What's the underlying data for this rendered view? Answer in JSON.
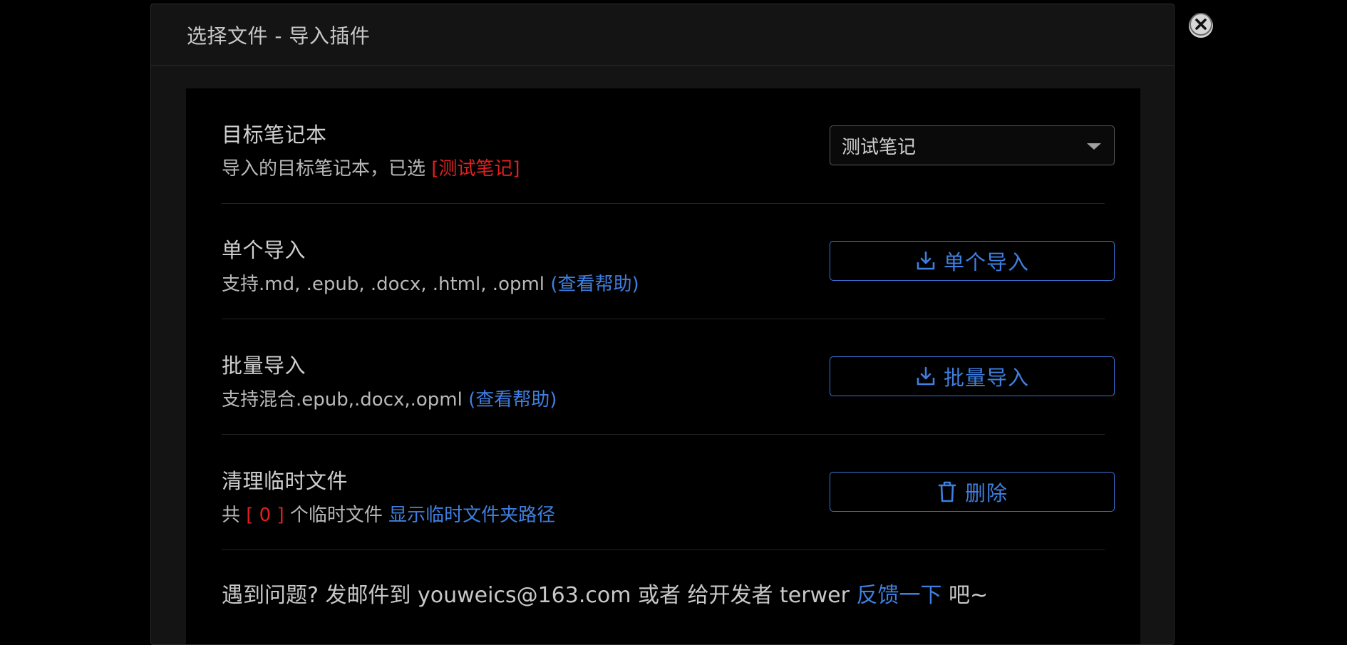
{
  "dialog": {
    "title": "选择文件 - 导入插件",
    "close_icon": "close-icon"
  },
  "notebook": {
    "title": "目标笔记本",
    "desc_prefix": "导入的目标笔记本，已选 ",
    "desc_selected": "[测试笔记]",
    "select_value": "测试笔记"
  },
  "single": {
    "title": "单个导入",
    "desc": "支持.md, .epub, .docx, .html, .opml ",
    "help_link": "(查看帮助)",
    "button_label": "单个导入",
    "button_icon": "download-icon"
  },
  "batch": {
    "title": "批量导入",
    "desc": "支持混合.epub,.docx,.opml ",
    "help_link": "(查看帮助)",
    "button_label": "批量导入",
    "button_icon": "download-icon"
  },
  "cleanup": {
    "title": "清理临时文件",
    "desc_prefix": "共 ",
    "count": "[ 0 ]",
    "desc_middle": " 个临时文件 ",
    "path_link": "显示临时文件夹路径",
    "button_label": "删除",
    "button_icon": "trash-icon"
  },
  "footer": {
    "text_prefix": "遇到问题? 发邮件到 youweics@163.com 或者 给开发者 terwer ",
    "feedback_link": "反馈一下",
    "text_suffix": " 吧~"
  },
  "colors": {
    "accent": "#3f7fe0",
    "danger": "#e02020",
    "background": "#000000",
    "dialog_bg": "#141414"
  }
}
